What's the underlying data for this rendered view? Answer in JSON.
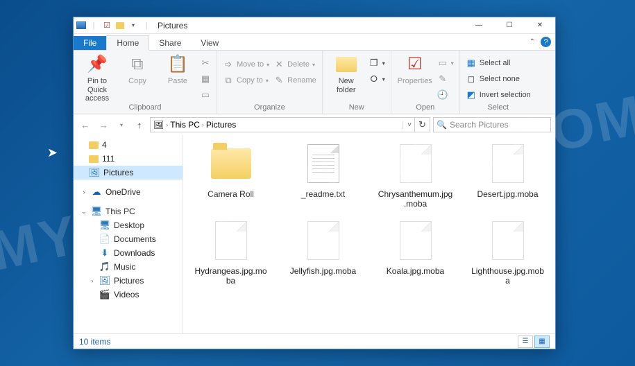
{
  "window": {
    "title": "Pictures"
  },
  "tabs": {
    "file": "File",
    "home": "Home",
    "share": "Share",
    "view": "View"
  },
  "ribbon": {
    "clipboard": {
      "label": "Clipboard",
      "pin": "Pin to Quick access",
      "copy": "Copy",
      "paste": "Paste"
    },
    "organize": {
      "label": "Organize",
      "moveto": "Move to",
      "copyto": "Copy to",
      "delete": "Delete",
      "rename": "Rename"
    },
    "new": {
      "label": "New",
      "newfolder": "New folder"
    },
    "open": {
      "label": "Open",
      "properties": "Properties"
    },
    "select": {
      "label": "Select",
      "all": "Select all",
      "none": "Select none",
      "invert": "Invert selection"
    }
  },
  "breadcrumb": {
    "root": "This PC",
    "current": "Pictures"
  },
  "search": {
    "placeholder": "Search Pictures"
  },
  "nav": {
    "items": [
      {
        "label": "4"
      },
      {
        "label": "111"
      },
      {
        "label": "Pictures"
      },
      {
        "label": "OneDrive"
      },
      {
        "label": "This PC"
      },
      {
        "label": "Desktop"
      },
      {
        "label": "Documents"
      },
      {
        "label": "Downloads"
      },
      {
        "label": "Music"
      },
      {
        "label": "Pictures"
      },
      {
        "label": "Videos"
      }
    ]
  },
  "files": [
    {
      "name": "Camera Roll",
      "type": "folder"
    },
    {
      "name": "_readme.txt",
      "type": "txt"
    },
    {
      "name": "Chrysanthemum.jpg.moba",
      "type": "blank"
    },
    {
      "name": "Desert.jpg.moba",
      "type": "blank"
    },
    {
      "name": "Hydrangeas.jpg.moba",
      "type": "blank"
    },
    {
      "name": "Jellyfish.jpg.moba",
      "type": "blank"
    },
    {
      "name": "Koala.jpg.moba",
      "type": "blank"
    },
    {
      "name": "Lighthouse.jpg.moba",
      "type": "blank"
    }
  ],
  "status": {
    "count": "10 items"
  }
}
